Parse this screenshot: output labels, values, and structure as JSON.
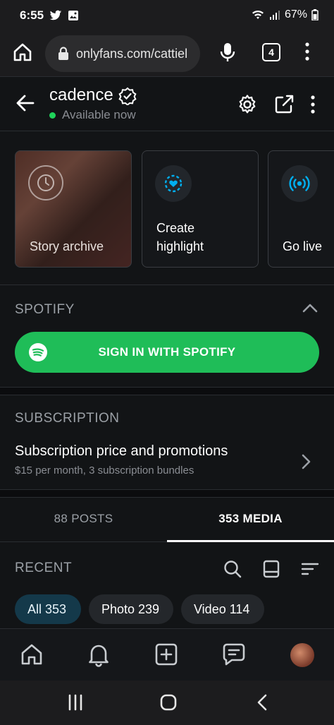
{
  "status_bar": {
    "time": "6:55",
    "battery": "67%"
  },
  "browser": {
    "url": "onlyfans.com/cattiel",
    "tab_count": "4"
  },
  "profile": {
    "name": "cadence",
    "status": "Available now"
  },
  "stories": [
    {
      "label": "Story archive"
    },
    {
      "label_line1": "Create",
      "label_line2": "highlight"
    },
    {
      "label": "Go live"
    }
  ],
  "spotify": {
    "title": "SPOTIFY",
    "button_label": "SIGN IN WITH SPOTIFY"
  },
  "subscription": {
    "title": "SUBSCRIPTION",
    "row_title": "Subscription price and promotions",
    "row_subtitle": "$15 per month, 3 subscription bundles"
  },
  "tabs": {
    "posts": "88 POSTS",
    "media": "353 MEDIA"
  },
  "recent": {
    "title": "RECENT",
    "chips": [
      {
        "label": "All 353"
      },
      {
        "label": "Photo 239"
      },
      {
        "label": "Video 114"
      }
    ]
  },
  "colors": {
    "accent_blue": "#00aff0",
    "spotify_green": "#1fbd58",
    "online_green": "#1fd35a"
  }
}
